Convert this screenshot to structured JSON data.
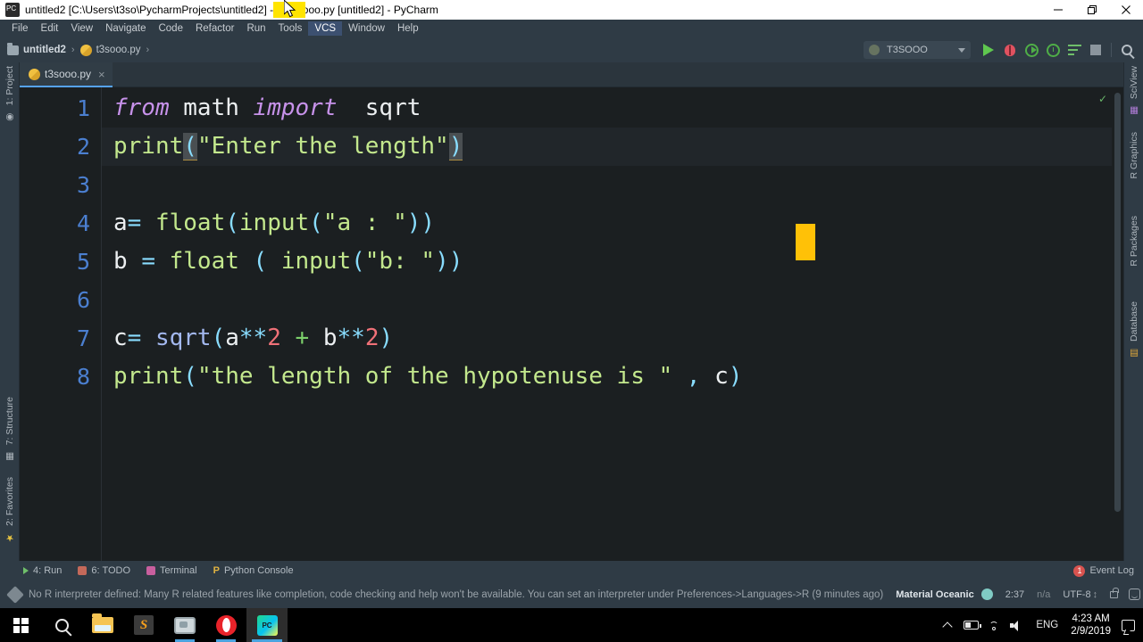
{
  "window": {
    "title": "untitled2 [C:\\Users\\t3so\\PycharmProjects\\untitled2] - ...\\t3sooo.py [untitled2] - PyCharm",
    "app_icon": "pycharm-icon",
    "minimize_label": "—",
    "restore_label": "❐",
    "close_label": "✕"
  },
  "menu": {
    "items": [
      {
        "label": "File"
      },
      {
        "label": "Edit"
      },
      {
        "label": "View"
      },
      {
        "label": "Navigate"
      },
      {
        "label": "Code"
      },
      {
        "label": "Refactor"
      },
      {
        "label": "Run"
      },
      {
        "label": "Tools"
      },
      {
        "label": "VCS"
      },
      {
        "label": "Window"
      },
      {
        "label": "Help"
      }
    ]
  },
  "navbar": {
    "breadcrumbs": [
      {
        "label": "untitled2",
        "icon": "folder-icon"
      },
      {
        "label": "t3sooo.py",
        "icon": "python-file-icon"
      }
    ],
    "separator": "›",
    "run_config": {
      "label": "T3SOOO",
      "icon": "run-config-icon",
      "caret": "chevron-down-icon"
    },
    "actions": [
      {
        "name": "run-button",
        "title": "Run"
      },
      {
        "name": "debug-button",
        "title": "Debug"
      },
      {
        "name": "run-with-coverage-button",
        "title": "Run with Coverage"
      },
      {
        "name": "profile-button",
        "title": "Profile"
      },
      {
        "name": "run-tests-button",
        "title": "Run Tests"
      },
      {
        "name": "stop-button",
        "title": "Stop"
      },
      {
        "name": "search-everywhere-button",
        "title": "Search Everywhere"
      }
    ]
  },
  "left_strip": {
    "items": [
      {
        "label": "1: Project",
        "icon": "project-icon"
      },
      {
        "label": "7: Structure",
        "icon": "structure-icon"
      },
      {
        "label": "2: Favorites",
        "icon": "star-icon"
      }
    ]
  },
  "right_strip": {
    "items": [
      {
        "label": "SciView",
        "icon": "sciview-icon"
      },
      {
        "label": "R Graphics",
        "icon": "r-graphics-icon"
      },
      {
        "label": "R Packages",
        "icon": "r-packages-icon"
      },
      {
        "label": "Database",
        "icon": "database-icon"
      }
    ]
  },
  "editor": {
    "tab": {
      "label": "t3sooo.py",
      "icon": "python-file-icon",
      "close": "×"
    },
    "inspection_status": "✓",
    "caret_position_line": 2,
    "lines": [
      {
        "n": "1",
        "text": "from math import  sqrt"
      },
      {
        "n": "2",
        "text": "print(\"Enter the length\")"
      },
      {
        "n": "3",
        "text": ""
      },
      {
        "n": "4",
        "text": "a= float(input(\"a : \"))"
      },
      {
        "n": "5",
        "text": "b = float ( input(\"b: \"))"
      },
      {
        "n": "6",
        "text": ""
      },
      {
        "n": "7",
        "text": "c= sqrt(a**2 + b**2)"
      },
      {
        "n": "8",
        "text": "print(\"the length of the hypotenuse is \" , c)"
      }
    ],
    "tokens": {
      "l1": {
        "from": "from",
        "math": " math ",
        "import": "import",
        "sqrt": "  sqrt"
      },
      "l2": {
        "print": "print",
        "lparen": "(",
        "string": "\"Enter the length\"",
        "rparen": ")"
      },
      "l4": {
        "var": "a",
        "eq": "=",
        "float": " float",
        "lp1": "(",
        "input": "input",
        "lp2": "(",
        "string": "\"a : \"",
        "rp": "))"
      },
      "l5": {
        "var": "b ",
        "eq": "=",
        "float": " float ",
        "lp1": "(",
        "input": " input",
        "lp2": "(",
        "string": "\"b: \"",
        "rp": "))"
      },
      "l7": {
        "var": "c",
        "eq": "=",
        "sqrt": " sqrt",
        "lp": "(",
        "a": "a",
        "pow1": "**",
        "two1": "2",
        "plus": " + ",
        "b": "b",
        "pow2": "**",
        "two2": "2",
        "rp": ")"
      },
      "l8": {
        "print": "print",
        "lp": "(",
        "string": "\"the length of the hypotenuse is \"",
        "comma": " , ",
        "c": "c",
        "rp": ")"
      }
    }
  },
  "tool_window_bar": {
    "items": [
      {
        "label": "4: Run",
        "icon": "run-icon"
      },
      {
        "label": "6: TODO",
        "icon": "todo-icon"
      },
      {
        "label": "Terminal",
        "icon": "terminal-icon"
      },
      {
        "label": "Python Console",
        "icon": "python-console-icon"
      }
    ],
    "event_log": {
      "label": "Event Log",
      "badge": "1"
    }
  },
  "status_bar": {
    "message": "No R interpreter defined: Many R related features like completion, code checking and help won't be available. You can set an interpreter under Preferences->Languages->R (9 minutes ago)",
    "warning_icon": "warning-icon",
    "theme": "Material Oceanic",
    "cursor": "2:37",
    "line_separator": "n/a",
    "encoding": "UTF-8",
    "encoding_caret": "↕",
    "lock_icon": "lock-icon",
    "face_icon": "feedback-face-icon"
  },
  "taskbar": {
    "buttons": [
      {
        "name": "start-button",
        "icon": "windows-logo-icon"
      },
      {
        "name": "search-button",
        "icon": "search-icon"
      },
      {
        "name": "file-explorer-button",
        "icon": "folder-icon"
      },
      {
        "name": "sublime-text-button",
        "icon": "sublime-text-icon"
      },
      {
        "name": "media-app-button",
        "icon": "monitor-icon"
      },
      {
        "name": "opera-button",
        "icon": "opera-icon"
      },
      {
        "name": "pycharm-button",
        "icon": "pycharm-icon"
      }
    ],
    "tray": {
      "chevron": "chevron-up-icon",
      "battery": "battery-icon",
      "wifi": "wifi-icon",
      "volume": "volume-icon",
      "language": "ENG",
      "time": "4:23 AM",
      "date": "2/9/2019",
      "notifications": "notification-icon"
    }
  },
  "colors": {
    "chrome": "#2f3b45",
    "editor_bg": "#1b1f21",
    "caret_line": "#21262a",
    "line_number": "#4b7fd0",
    "keyword": "#c792ea",
    "string": "#c3e88d",
    "number": "#f07178",
    "paren": "#89ddff",
    "builtin": "#a3b8ef",
    "caret_block": "#ffc107",
    "tab_underline": "#56a3f5"
  }
}
